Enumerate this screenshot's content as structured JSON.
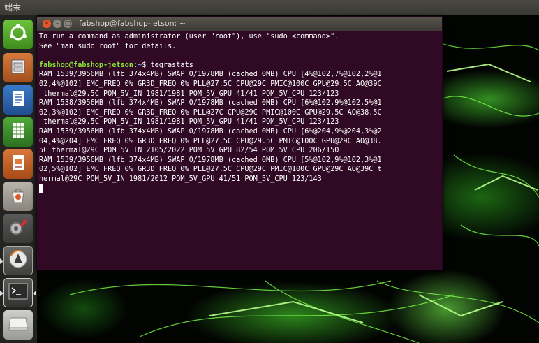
{
  "top_panel": {
    "title": "端末"
  },
  "terminal": {
    "title": "fabshop@fabshop-jetson: ~",
    "buttons": [
      "close",
      "minimize",
      "maximize"
    ],
    "motd": [
      "To run a command as administrator (user \"root\"), use \"sudo <command>\".",
      "See \"man sudo_root\" for details."
    ],
    "prompt": {
      "user_host": "fabshop@fabshop-jetson",
      "sep": ":",
      "path": "~",
      "symbol": "$",
      "command": "tegrastats"
    },
    "output": [
      "RAM 1539/3956MB (lfb 374x4MB) SWAP 0/1978MB (cached 0MB) CPU [4%@102,7%@102,2%@1",
      "02,4%@102] EMC_FREQ 0% GR3D_FREQ 0% PLL@27.5C CPU@29C PMIC@100C GPU@29.5C AO@39C",
      " thermal@29.5C POM_5V_IN 1981/1981 POM_5V_GPU 41/41 POM_5V_CPU 123/123",
      "RAM 1538/3956MB (lfb 374x4MB) SWAP 0/1978MB (cached 0MB) CPU [6%@102,9%@102,5%@1",
      "02,3%@102] EMC_FREQ 0% GR3D_FREQ 0% PLL@27C CPU@29C PMIC@100C GPU@29.5C AO@38.5C",
      " thermal@29.5C POM_5V_IN 1981/1981 POM_5V_GPU 41/41 POM_5V_CPU 123/123",
      "RAM 1539/3956MB (lfb 374x4MB) SWAP 0/1978MB (cached 0MB) CPU [6%@204,9%@204,3%@2",
      "04,4%@204] EMC_FREQ 0% GR3D_FREQ 0% PLL@27.5C CPU@29.5C PMIC@100C GPU@29C AO@38.",
      "5C thermal@29C POM_5V_IN 2105/2022 POM_5V_GPU 82/54 POM_5V_CPU 206/150",
      "RAM 1539/3956MB (lfb 374x4MB) SWAP 0/1978MB (cached 0MB) CPU [5%@102,9%@102,3%@1",
      "02,5%@102] EMC_FREQ 0% GR3D_FREQ 0% PLL@27.5C CPU@29C PMIC@100C GPU@29C AO@39C t",
      "hermal@29C POM_5V_IN 1981/2012 POM_5V_GPU 41/51 POM_5V_CPU 123/143"
    ]
  },
  "launcher": {
    "items": [
      {
        "name": "dash",
        "icon": "ubuntu-logo-icon"
      },
      {
        "name": "files",
        "icon": "file-cabinet-icon"
      },
      {
        "name": "writer",
        "icon": "document-icon"
      },
      {
        "name": "calc",
        "icon": "spreadsheet-icon"
      },
      {
        "name": "impress",
        "icon": "presentation-icon"
      },
      {
        "name": "software-center",
        "icon": "shopping-bag-icon"
      },
      {
        "name": "system-settings",
        "icon": "wrench-gear-icon"
      },
      {
        "name": "update-manager",
        "icon": "update-icon"
      },
      {
        "name": "terminal",
        "icon": "terminal-icon"
      },
      {
        "name": "drive",
        "icon": "drive-icon"
      }
    ]
  },
  "colors": {
    "terminal_bg": "#300a24",
    "prompt_user": "#8ae234",
    "prompt_path": "#729fcf",
    "launcher_bg": "#282826"
  }
}
